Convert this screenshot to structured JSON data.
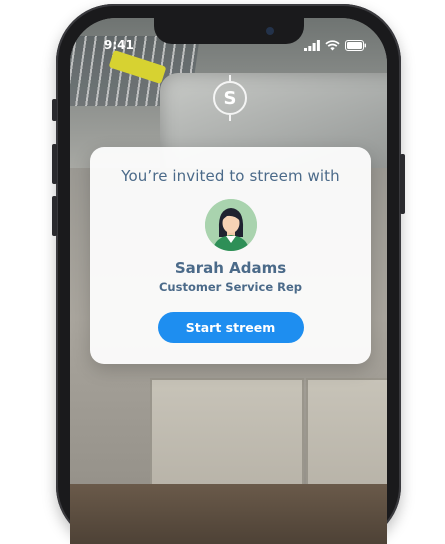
{
  "status_bar": {
    "time": "9:41"
  },
  "invite": {
    "title": "You’re invited to streem with",
    "name": "Sarah Adams",
    "role": "Customer Service Rep",
    "start_label": "Start streem"
  },
  "brand": {
    "icon": "streem-logo-icon",
    "glyph": "S"
  },
  "colors": {
    "accent": "#1e8ef0",
    "text": "#4b6a89",
    "avatar_bg": "#a9d3ae"
  }
}
